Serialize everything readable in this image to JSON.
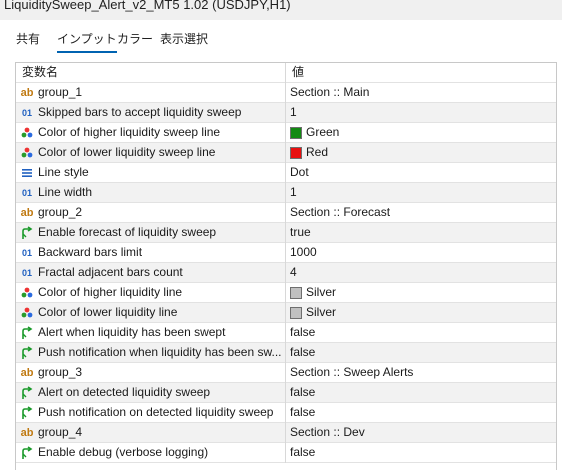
{
  "window": {
    "title": "LiquiditySweep_Alert_v2_MT5 1.02 (USDJPY,H1)"
  },
  "tabs": [
    {
      "label": "共有"
    },
    {
      "label": "インプット"
    },
    {
      "label": "カラー"
    },
    {
      "label": "表示選択"
    }
  ],
  "active_tab": "インプット",
  "table": {
    "headers": {
      "name": "変数名",
      "value": "値"
    },
    "rows": [
      {
        "icon": "ab-icon",
        "name": "group_1",
        "value": "Section :: Main"
      },
      {
        "icon": "integer-icon",
        "name": "Skipped bars to accept liquidity sweep",
        "value": "1"
      },
      {
        "icon": "color-icon",
        "name": "Color of higher liquidity sweep line",
        "value": "Green",
        "swatch": "#138a13"
      },
      {
        "icon": "color-icon",
        "name": "Color of lower liquidity sweep line",
        "value": "Red",
        "swatch": "#e81010"
      },
      {
        "icon": "enum-icon",
        "name": "Line style",
        "value": "Dot"
      },
      {
        "icon": "integer-icon",
        "name": "Line width",
        "value": "1"
      },
      {
        "icon": "ab-icon",
        "name": "group_2",
        "value": "Section :: Forecast"
      },
      {
        "icon": "bool-icon",
        "name": "Enable forecast of liquidity sweep",
        "value": "true"
      },
      {
        "icon": "integer-icon",
        "name": "Backward bars limit",
        "value": "1000"
      },
      {
        "icon": "integer-icon",
        "name": "Fractal adjacent bars count",
        "value": "4"
      },
      {
        "icon": "color-icon",
        "name": "Color of higher liquidity line",
        "value": "Silver",
        "swatch": "#c0c0c0"
      },
      {
        "icon": "color-icon",
        "name": "Color of lower liquidity line",
        "value": "Silver",
        "swatch": "#c0c0c0"
      },
      {
        "icon": "bool-icon",
        "name": "Alert when liquidity has been swept",
        "value": "false"
      },
      {
        "icon": "bool-icon",
        "name": "Push notification when liquidity has been sw...",
        "value": "false"
      },
      {
        "icon": "ab-icon",
        "name": "group_3",
        "value": "Section :: Sweep Alerts"
      },
      {
        "icon": "bool-icon",
        "name": "Alert on detected liquidity sweep",
        "value": "false"
      },
      {
        "icon": "bool-icon",
        "name": "Push notification on detected liquidity sweep",
        "value": "false"
      },
      {
        "icon": "ab-icon",
        "name": "group_4",
        "value": "Section :: Dev"
      },
      {
        "icon": "bool-icon",
        "name": "Enable debug (verbose logging)",
        "value": "false"
      }
    ]
  },
  "colors": {
    "accent": "#0063b1",
    "row_alt": "#f2f2f2",
    "ab_icon": "#c07a12",
    "integer_icon": "#2060c0",
    "bool_icon": "#1a9a2a"
  }
}
